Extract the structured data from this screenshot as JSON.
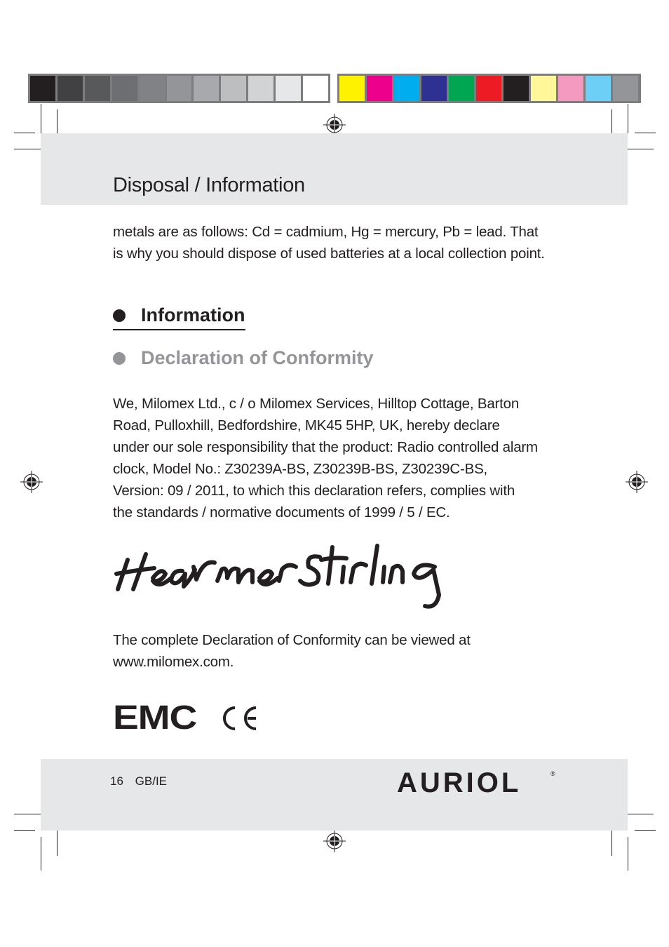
{
  "print_marks": {
    "grayscale_swatches": [
      "#231f20",
      "#414042",
      "#58595b",
      "#6d6e71",
      "#808285",
      "#939598",
      "#a7a9ac",
      "#bcbec0",
      "#d1d3d4",
      "#e6e7e8",
      "#ffffff"
    ],
    "color_swatches": [
      "#fff200",
      "#ec008c",
      "#00aeef",
      "#2e3192",
      "#00a651",
      "#ed1c24",
      "#231f20",
      "#fff799",
      "#f49ac1",
      "#6dcff6",
      "#939598"
    ]
  },
  "header": {
    "title": "Disposal / Information"
  },
  "intro_paragraph": {
    "lines": [
      "metals are as follows: Cd = cadmium, Hg = mercury, Pb = lead. That",
      "is why you should dispose of used batteries at a local collection point."
    ]
  },
  "sections": [
    {
      "label": "Information",
      "style": "primary"
    },
    {
      "label": "Declaration of Conformity",
      "style": "secondary"
    }
  ],
  "declaration": {
    "lines": [
      "We, Milomex Ltd., c / o Milomex Services, Hilltop Cottage, Barton",
      "Road, Pulloxhill, Bedfordshire, MK45 5HP, UK, hereby declare",
      "under our sole responsibility that the product: Radio controlled alarm",
      "clock, Model No.: Z30239A-BS, Z30239B-BS, Z30239C-BS,",
      "Version: 09 / 2011, to which this declaration refers, complies with",
      "the standards / normative documents of 1999 / 5 / EC."
    ]
  },
  "signature": {
    "icon": "handwritten-signature"
  },
  "complete_declaration": {
    "lines": [
      "The complete Declaration of Conformity can be viewed at",
      "www.milomex.com."
    ]
  },
  "certifications": {
    "emc_label": "EMC",
    "ce_icon": "ce-mark-icon"
  },
  "footer": {
    "page_number": "16",
    "locale": "GB/IE",
    "brand": "AURIOL",
    "brand_mark": "®"
  }
}
